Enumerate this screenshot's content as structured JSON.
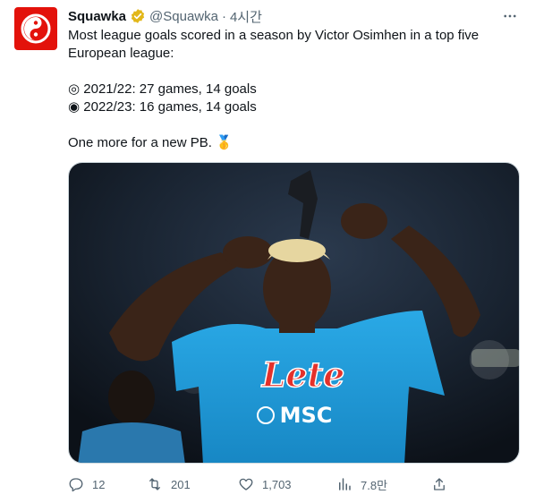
{
  "tweet": {
    "author_name": "Squawka",
    "handle": "@Squawka",
    "separator": "·",
    "time": "4시간",
    "lines": [
      "Most league goals scored in a season by Victor Osimhen in a top five",
      "European league:",
      "",
      "◎ 2021/22: 27 games, 14 goals",
      "◉ 2022/23: 16 games, 14 goals",
      "",
      "One more for a new PB. 🥇"
    ]
  },
  "media": {
    "jersey_sponsor": "Lete",
    "jersey_brand": "MSC"
  },
  "actions": {
    "reply_count": "12",
    "retweet_count": "201",
    "like_count": "1,703",
    "views_count": "7.8만"
  },
  "colors": {
    "brand_red": "#e3120b",
    "verified_gold": "#e2b719",
    "muted": "#536471",
    "jersey_blue": "#1f9fde"
  },
  "icons": {
    "verified": "verified-badge-icon",
    "more": "more-icon",
    "reply": "reply-icon",
    "retweet": "retweet-icon",
    "like": "like-icon",
    "views": "views-icon",
    "share": "share-icon"
  }
}
